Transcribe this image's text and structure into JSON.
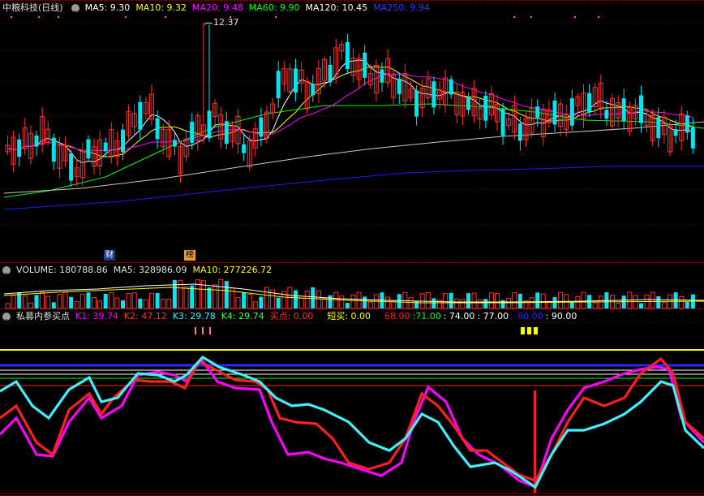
{
  "colors": {
    "background": "#000000",
    "grid": "#5a0000",
    "up": "#ff3232",
    "down": "#00e5ee",
    "ma5": "#ffffff",
    "ma10": "#ffff00",
    "ma20": "#ff00ff",
    "ma60": "#00ff00",
    "ma120": "#c8c8c8",
    "ma250": "#1c1cff",
    "k1": "#ff00ff",
    "k2": "#ff2020",
    "k3": "#40f0ff",
    "k4": "#ff00ff"
  },
  "price_panel": {
    "title": "中粮科技(日线)",
    "ma": [
      {
        "label": "MA5: 9.30",
        "color": "#ffffff"
      },
      {
        "label": "MA10: 9.32",
        "color": "#ffff00"
      },
      {
        "label": "MA20: 9.48",
        "color": "#ff00ff"
      },
      {
        "label": "MA60: 9.90",
        "color": "#00ff00"
      },
      {
        "label": "MA120: 10.45",
        "color": "#ffffff"
      },
      {
        "label": "MA250: 9.94",
        "color": "#3535ff"
      }
    ],
    "high_marker": "12.37",
    "tag_cai": "财",
    "tag_bang": "榜"
  },
  "volume_panel": {
    "label": "VOLUME: 180788.86",
    "ma5": "MA5: 328986.09",
    "ma10": "MA10: 277226.72"
  },
  "indicator_panel": {
    "title": "私募内参买点",
    "k1": "K1: 39.74",
    "k2": "K2: 47.12",
    "k3": "K3: 29.78",
    "k4": "K4: 29.74",
    "buy": "买点: 0.00",
    "short_buy": "短买: 0.00",
    "levels": [
      {
        "label": "68.00",
        "color": "#ff2020"
      },
      {
        "label": ":71.00",
        "color": "#00ff00"
      },
      {
        "label": ": 74.00",
        "color": "#ffffff"
      },
      {
        "label": ": 77.00",
        "color": "#ffffff"
      },
      {
        "label": "80.00",
        "color": "#2a2aff"
      },
      {
        "label": ": 90.00",
        "color": "#ffffff"
      }
    ]
  }
}
